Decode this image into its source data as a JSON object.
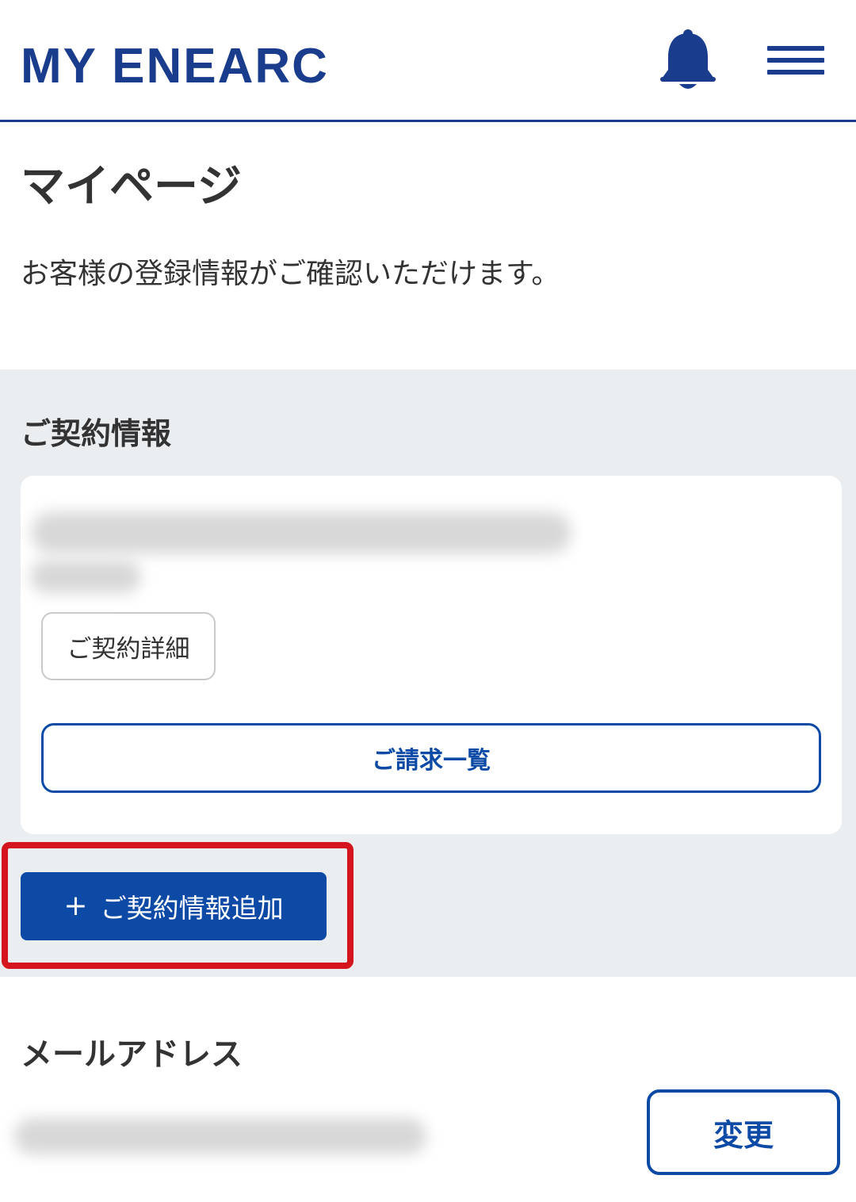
{
  "header": {
    "logo_text": "MY ENEARC",
    "notification_icon": "bell-icon",
    "menu_icon": "hamburger-menu-icon",
    "brand_color": "#1a3c8c"
  },
  "page": {
    "title": "マイページ",
    "description": "お客様の登録情報がご確認いただけます。"
  },
  "contract_section": {
    "heading": "ご契約情報",
    "contract_detail_label": "ご契約詳細",
    "billing_list_label": "ご請求一覧",
    "add_contract_icon": "plus-icon",
    "add_contract_symbol": "+",
    "add_contract_label": "ご契約情報追加",
    "button_color": "#0d4aa5",
    "highlight_color": "#d4151d",
    "background_color": "#ebeef1"
  },
  "email_section": {
    "heading": "メールアドレス",
    "change_label": "変更"
  }
}
